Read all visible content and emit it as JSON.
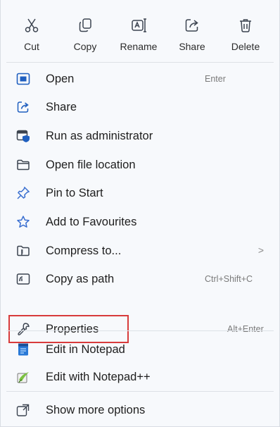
{
  "quick_actions": [
    {
      "label": "Cut",
      "icon": "scissors-icon"
    },
    {
      "label": "Copy",
      "icon": "copy-icon"
    },
    {
      "label": "Rename",
      "icon": "rename-icon"
    },
    {
      "label": "Share",
      "icon": "share-icon"
    },
    {
      "label": "Delete",
      "icon": "trash-icon"
    }
  ],
  "items": [
    {
      "label": "Open",
      "shortcut": "Enter",
      "icon": "open-window-icon"
    },
    {
      "label": "Share",
      "icon": "share-icon"
    },
    {
      "label": "Run as administrator",
      "icon": "admin-shield-icon"
    },
    {
      "label": "Open file location",
      "icon": "folder-icon"
    },
    {
      "label": "Pin to Start",
      "icon": "pin-icon"
    },
    {
      "label": "Add to Favourites",
      "icon": "star-icon"
    },
    {
      "label": "Compress to...",
      "submenu": ">",
      "icon": "zip-folder-icon"
    },
    {
      "label": "Copy as path",
      "shortcut": "Ctrl+Shift+C",
      "icon": "copy-path-icon"
    },
    {
      "label": "Properties",
      "shortcut": "Alt+Enter",
      "icon": "wrench-icon",
      "highlighted": true
    },
    {
      "label": "Edit in Notepad",
      "icon": "notepad-icon"
    },
    {
      "label": "Edit with Notepad++",
      "icon": "notepadpp-icon"
    },
    {
      "label": "Show more options",
      "icon": "more-options-icon"
    }
  ],
  "colors": {
    "highlight_border": "#d83b3b",
    "icon_blue": "#1f5fbf",
    "background": "#f7f9fc"
  }
}
